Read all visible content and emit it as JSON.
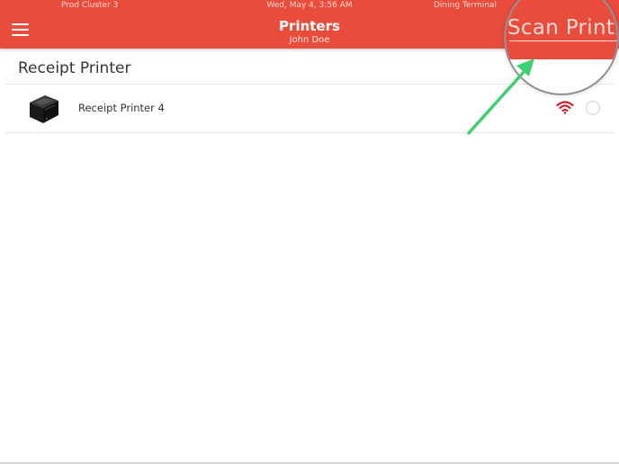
{
  "status_bar": {
    "cluster": "Prod Cluster 3",
    "datetime": "Wed, May 4, 3:56 AM",
    "terminal": "Dining Terminal"
  },
  "header": {
    "title": "Printers",
    "user": "John Doe",
    "accent_color": "#ea4c3c"
  },
  "magnifier": {
    "label": "Scan Print"
  },
  "section": {
    "title": "Receipt Printer"
  },
  "printers": [
    {
      "name": "Receipt Printer 4",
      "icon": "receipt-printer-icon",
      "status_icon": "wifi-icon",
      "status_color": "#d0202a",
      "selected": false
    }
  ],
  "annotation": {
    "icon": "green-arrow",
    "color": "#3fcf6f"
  }
}
